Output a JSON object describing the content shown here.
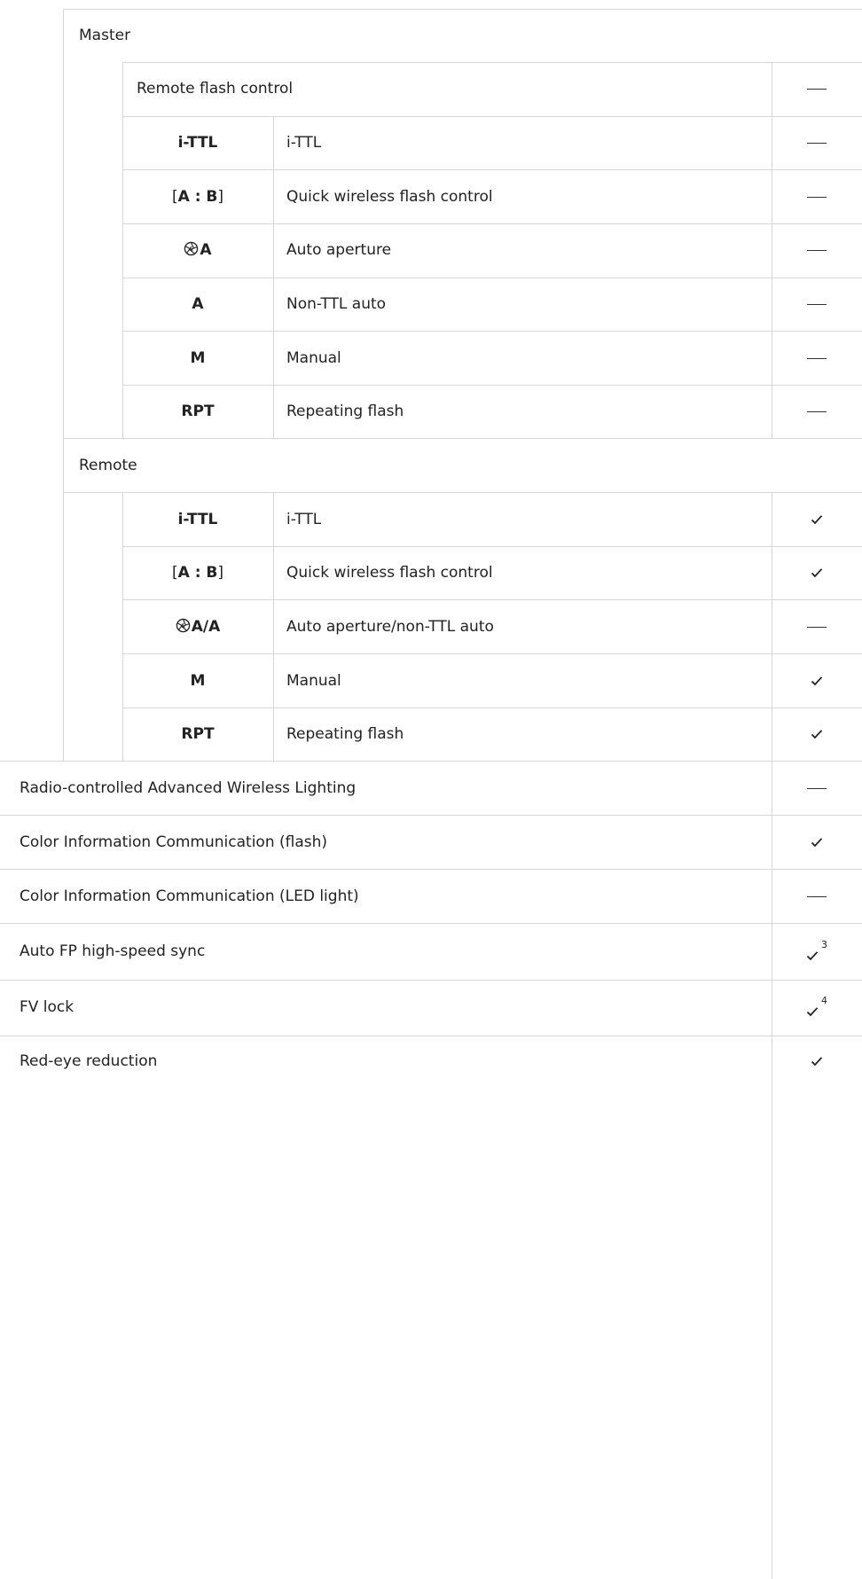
{
  "sections": {
    "master": {
      "label": "Master",
      "remote_flash_control": {
        "label": "Remote flash control",
        "support": "dash"
      },
      "modes": [
        {
          "code": "i-TTL",
          "desc": "i-TTL",
          "support": "dash"
        },
        {
          "code_open": "[",
          "code_a": "A",
          "code_sep": " : ",
          "code_b": "B",
          "code_close": "]",
          "desc": "Quick wireless flash control",
          "support": "dash",
          "bracket": true
        },
        {
          "code": "A",
          "icon": "aperture-icon",
          "desc": "Auto aperture",
          "support": "dash"
        },
        {
          "code": "A",
          "desc": "Non-TTL auto",
          "support": "dash"
        },
        {
          "code": "M",
          "desc": "Manual",
          "support": "dash"
        },
        {
          "code": "RPT",
          "desc": "Repeating flash",
          "support": "dash"
        }
      ]
    },
    "remote": {
      "label": "Remote",
      "modes": [
        {
          "code": "i-TTL",
          "desc": "i-TTL",
          "support": "check"
        },
        {
          "code_open": "[",
          "code_a": "A",
          "code_sep": " : ",
          "code_b": "B",
          "code_close": "]",
          "desc": "Quick wireless flash control",
          "support": "check",
          "bracket": true
        },
        {
          "code": "A/A",
          "icon": "aperture-icon",
          "desc": "Auto aperture/non-TTL auto",
          "support": "dash"
        },
        {
          "code": "M",
          "desc": "Manual",
          "support": "check"
        },
        {
          "code": "RPT",
          "desc": "Repeating flash",
          "support": "check"
        }
      ]
    }
  },
  "features": [
    {
      "label": "Radio-controlled Advanced Wireless Lighting",
      "support": "dash"
    },
    {
      "label": "Color Information Communication (flash)",
      "support": "check"
    },
    {
      "label": "Color Information Communication (LED light)",
      "support": "dash"
    },
    {
      "label": "Auto FP high-speed sync",
      "support": "check",
      "note": "3"
    },
    {
      "label": "FV lock",
      "support": "check",
      "note": "4"
    },
    {
      "label": "Red-eye reduction",
      "support": "check"
    }
  ],
  "colors": {
    "border": "#d6d6d6",
    "text": "#222222"
  }
}
